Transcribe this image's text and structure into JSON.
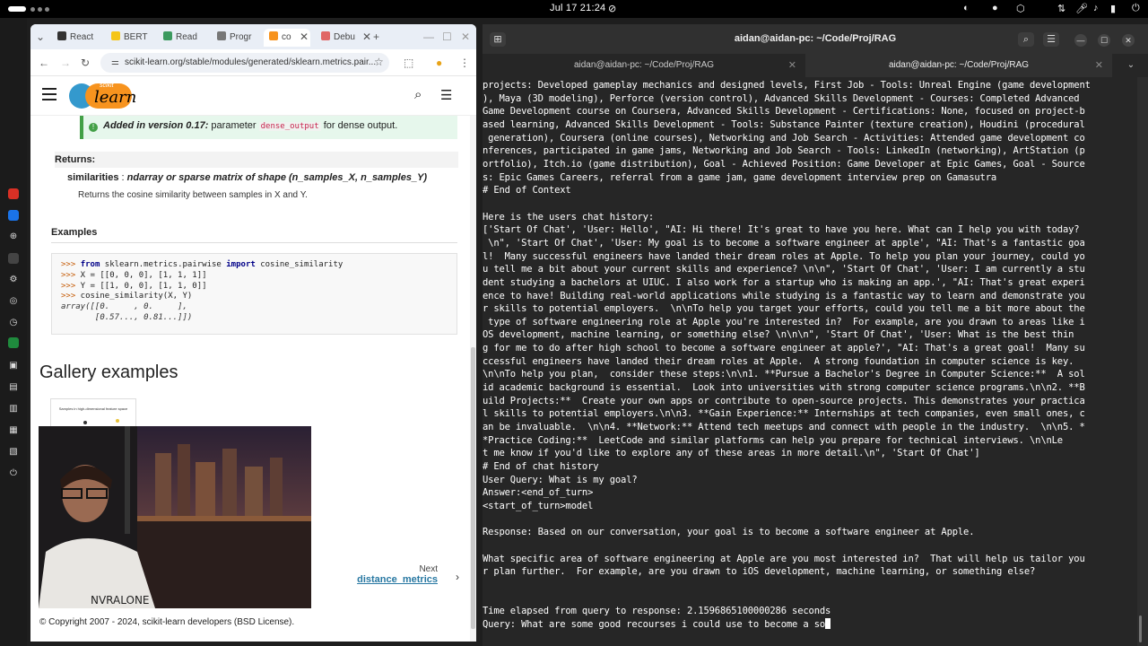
{
  "topbar": {
    "clock": "Jul 17  21:24"
  },
  "browser": {
    "tabs": [
      {
        "label": "React",
        "color": "#333333"
      },
      {
        "label": "BERT",
        "color": "#f5c518"
      },
      {
        "label": "Read",
        "color": "#3c9a5f"
      },
      {
        "label": "Progr",
        "color": "#666666"
      },
      {
        "label": "co",
        "color": "#f7931e"
      },
      {
        "label": "Debu",
        "color": "#e06666"
      }
    ],
    "url": "scikit-learn.org/stable/modules/generated/sklearn.metrics.pair...",
    "logo_small": "scikit",
    "logo_big": "learn"
  },
  "doc": {
    "added_label": "Added in version 0.17:",
    "added_text": " parameter ",
    "added_code": "dense_output",
    "added_tail": " for dense output.",
    "returns_label": "Returns:",
    "sim_name": "similarities",
    "sim_sep": " : ",
    "sim_type": "ndarray or sparse matrix of shape (n_samples_X, n_samples_Y)",
    "sim_desc": "Returns the cosine similarity between samples in X and Y.",
    "examples_heading": "Examples",
    "code": {
      "l1_kw1": "from",
      "l1_mod": " sklearn.metrics.pairwise ",
      "l1_kw2": "import",
      "l1_name": " cosine_similarity",
      "l2": " X = [[0, 0, 0], [1, 1, 1]]",
      "l3": " Y = [[1, 0, 0], [1, 1, 0]]",
      "l4": " cosine_similarity(X, Y)",
      "out1": "array([[0.     , 0.     ],",
      "out2": "       [0.57..., 0.81...]])",
      "prompt": ">>>"
    },
    "gallery_heading": "Gallery examples",
    "thumb_caption": "Samples in high-dimensional feature space",
    "next_label": "Next",
    "next_link": "distance_metrics",
    "copyright": "© Copyright 2007 - 2024, scikit-learn developers (BSD License)."
  },
  "terminal": {
    "title": "aidan@aidan-pc: ~/Code/Proj/RAG",
    "tabs": [
      "aidan@aidan-pc: ~/Code/Proj/RAG",
      "aidan@aidan-pc: ~/Code/Proj/RAG"
    ],
    "lines": [
      "projects: Developed gameplay mechanics and designed levels, First Job - Tools: Unreal Engine (game development",
      "), Maya (3D modeling), Perforce (version control), Advanced Skills Development - Courses: Completed Advanced",
      "Game Development course on Coursera, Advanced Skills Development - Certifications: None, focused on project-b",
      "ased learning, Advanced Skills Development - Tools: Substance Painter (texture creation), Houdini (procedural",
      " generation), Coursera (online courses), Networking and Job Search - Activities: Attended game development co",
      "nferences, participated in game jams, Networking and Job Search - Tools: LinkedIn (networking), ArtStation (p",
      "ortfolio), Itch.io (game distribution), Goal - Achieved Position: Game Developer at Epic Games, Goal - Source",
      "s: Epic Games Careers, referral from a game jam, game development interview prep on Gamasutra",
      "# End of Context",
      "",
      "Here is the users chat history:",
      "['Start Of Chat', 'User: Hello', \"AI: Hi there! It's great to have you here. What can I help you with today?",
      " \\n\", 'Start Of Chat', 'User: My goal is to become a software engineer at apple', \"AI: That's a fantastic goa",
      "l!  Many successful engineers have landed their dream roles at Apple. To help you plan your journey, could yo",
      "u tell me a bit about your current skills and experience? \\n\\n\", 'Start Of Chat', 'User: I am currently a stu",
      "dent studying a bachelors at UIUC. I also work for a startup who is making an app.', \"AI: That's great experi",
      "ence to have! Building real-world applications while studying is a fantastic way to learn and demonstrate you",
      "r skills to potential employers.  \\n\\nTo help you target your efforts, could you tell me a bit more about the",
      " type of software engineering role at Apple you're interested in?  For example, are you drawn to areas like i",
      "OS development, machine learning, or something else? \\n\\n\\n\", 'Start Of Chat', 'User: What is the best thin",
      "g for me to do after high school to become a software engineer at apple?', \"AI: That's a great goal!  Many su",
      "ccessful engineers have landed their dream roles at Apple.  A strong foundation in computer science is key.",
      "\\n\\nTo help you plan,  consider these steps:\\n\\n1. **Pursue a Bachelor's Degree in Computer Science:**  A sol",
      "id academic background is essential.  Look into universities with strong computer science programs.\\n\\n2. **B",
      "uild Projects:**  Create your own apps or contribute to open-source projects. This demonstrates your practica",
      "l skills to potential employers.\\n\\n3. **Gain Experience:** Internships at tech companies, even small ones, c",
      "an be invaluable.  \\n\\n4. **Network:** Attend tech meetups and connect with people in the industry.  \\n\\n5. *",
      "*Practice Coding:**  LeetCode and similar platforms can help you prepare for technical interviews. \\n\\nLe",
      "t me know if you'd like to explore any of these areas in more detail.\\n\", 'Start Of Chat']",
      "# End of chat history",
      "User Query: What is my goal?",
      "Answer:<end_of_turn>",
      "<start_of_turn>model",
      "",
      "Response: Based on our conversation, your goal is to become a software engineer at Apple.",
      "",
      "What specific area of software engineering at Apple are you most interested in?  That will help us tailor you",
      "r plan further.  For example, are you drawn to iOS development, machine learning, or something else?",
      "",
      "",
      "Time elapsed from query to response: 2.1596865100000286 seconds"
    ],
    "prompt_line": "Query: What are some good recourses i could use to become a so"
  }
}
